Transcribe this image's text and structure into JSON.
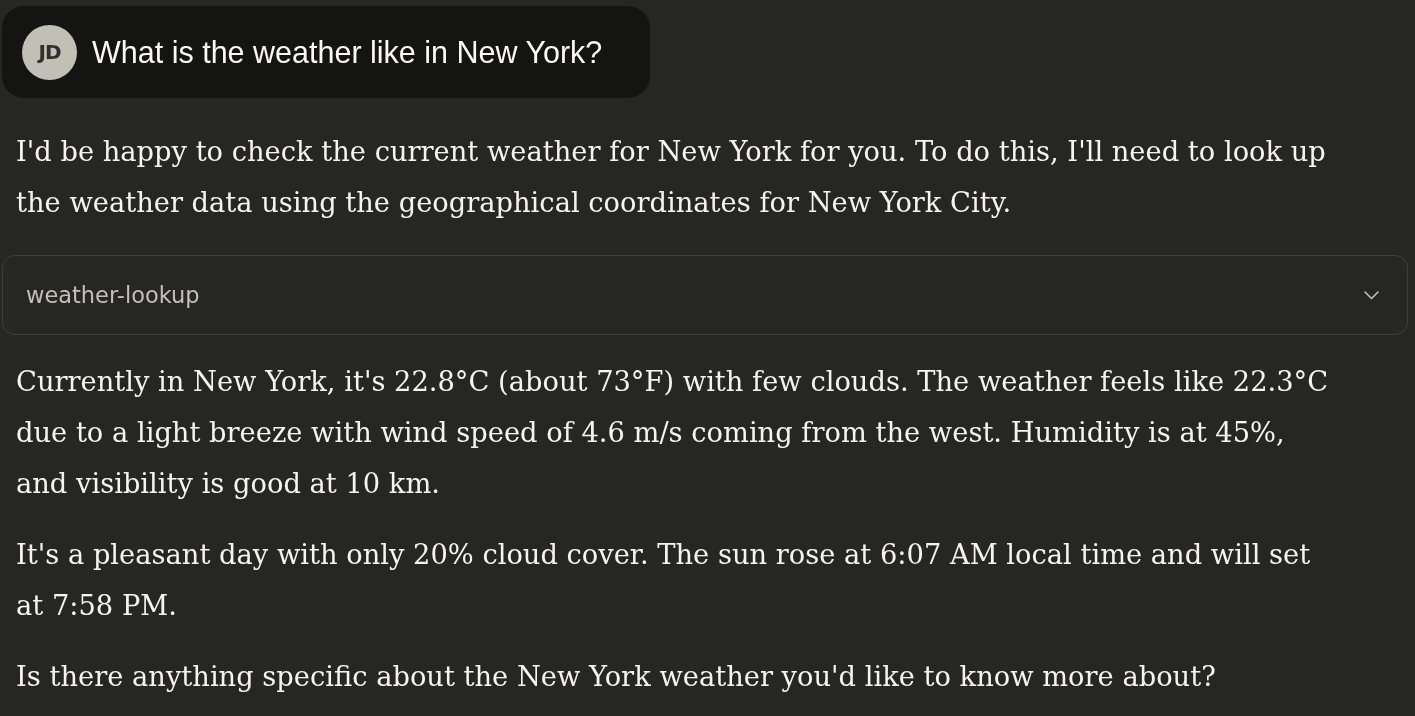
{
  "user_message": {
    "avatar": "JD",
    "text": "What is the weather like in New York?"
  },
  "response": [
    {
      "kind": "paragraph",
      "text": "I'd be happy to check the current weather for New York for you. To do this, I'll need to look up the weather data using the geographical coordinates for New York City."
    },
    {
      "kind": "tool",
      "name": "weather-lookup",
      "expanded": false
    },
    {
      "kind": "paragraph",
      "text": "Currently in New York, it's 22.8°C (about 73°F) with few clouds. The weather feels like 22.3°C due to a light breeze with wind speed of 4.6 m/s coming from the west. Humidity is at 45%, and visibility is good at 10 km."
    },
    {
      "kind": "paragraph",
      "text": "It's a pleasant day with only 20% cloud cover. The sun rose at 6:07 AM local time and will set at 7:58 PM."
    },
    {
      "kind": "paragraph",
      "text": "Is there anything specific about the New York weather you'd like to know more about?"
    }
  ]
}
